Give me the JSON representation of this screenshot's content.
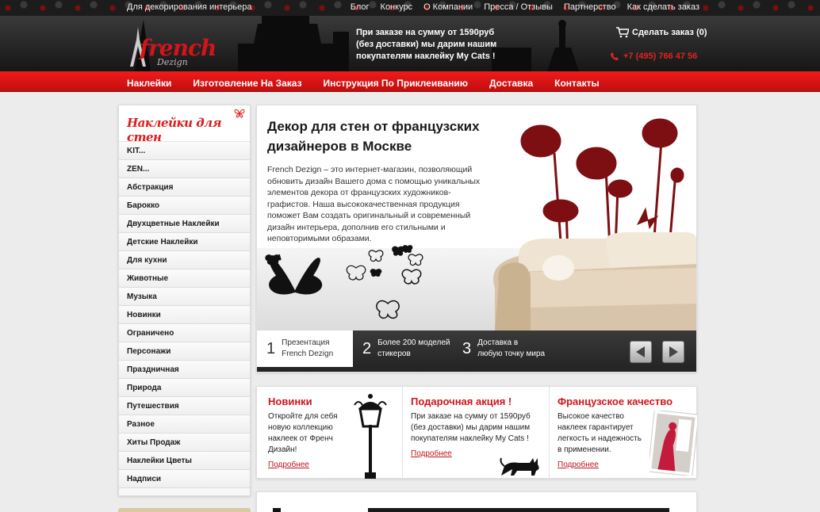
{
  "top": {
    "tagline": "Для декорирования интерьера",
    "links": [
      "Блог",
      "Конкурс",
      "О Компании",
      "Пресса / Отзывы",
      "Партнерство",
      "Как сделать заказ"
    ]
  },
  "header": {
    "logo_main": "french",
    "logo_sub": "Dezign",
    "promo": "При заказе на сумму от 1590руб (без доставки) мы дарим нашим покупателям наклейку My Cats !",
    "cart": "Сделать заказ (0)",
    "phone": "+7 (495) 766 47 56"
  },
  "nav": [
    "Наклейки",
    "Изготовление На Заказ",
    "Инструкция По Приклеиванию",
    "Доставка",
    "Контакты"
  ],
  "sidebar": {
    "title": "Наклейки для стен",
    "items": [
      "KIT...",
      "ZEN...",
      "Абстракция",
      "Барокко",
      "Двухцветные Наклейки",
      "Детские Наклейки",
      "Для кухни",
      "Животные",
      "Музыка",
      "Новинки",
      "Ограничено",
      "Персонажи",
      "Праздничная",
      "Природа",
      "Путешествия",
      "Разное",
      "Хиты Продаж",
      "Наклейки Цветы",
      "Надписи"
    ]
  },
  "hero": {
    "title": "Декор для стен от французских дизайнеров в Москве",
    "text": "French Dezign – это интернет-магазин, позволяющий обновить дизайн Вашего дома с помощью уникальных элементов декора от французских художников-графистов. Наша высококачественная продукция поможет Вам создать оригинальный и современный дизайн интерьера, дополнив его стильными и неповторимыми образами.",
    "steps": [
      {
        "num": "1",
        "text": "Презентация French Dezign"
      },
      {
        "num": "2",
        "text": "Более 200 моделей стикеров"
      },
      {
        "num": "3",
        "text": "Доставка в любую точку мира"
      }
    ]
  },
  "features": [
    {
      "title": "Новинки",
      "text": "Откройте для себя новую коллекцию наклеек от Френч Дизайн!",
      "link": "Подробнее"
    },
    {
      "title": "Подарочная акция !",
      "text": "При заказе на сумму от 1590руб (без доставки) мы дарим нашим покупателям наклейку My Cats !",
      "link": "Подробнее"
    },
    {
      "title": "Французское качество",
      "text": "Высокое качество наклеек гарантирует легкость и надежность в применении.",
      "link": "Подробнее"
    }
  ],
  "colors": {
    "accent": "#d0141b",
    "nav": "#e01616",
    "dark": "#1c1c1c"
  }
}
